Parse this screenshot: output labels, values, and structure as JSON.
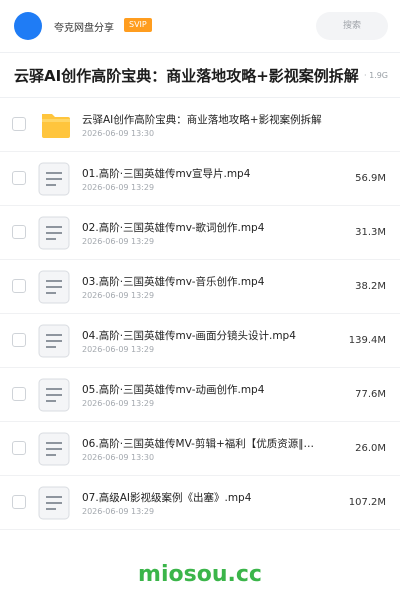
{
  "header": {
    "sharer_name": "夸克网盘分享",
    "badge": "SVIP",
    "search_placeholder": "搜索"
  },
  "folder": {
    "title": "云驿AI创作高阶宝典：商业落地攻略+影视案例拆解",
    "total_size": "· 1.9G"
  },
  "files": [
    {
      "type": "folder",
      "name": "云驿AI创作高阶宝典：商业落地攻略+影视案例拆解",
      "date": "2026-06-09 13:30",
      "size": ""
    },
    {
      "type": "video",
      "name": "01.高阶·三国英雄传mv宣导片.mp4",
      "date": "2026-06-09 13:29",
      "size": "56.9M"
    },
    {
      "type": "video",
      "name": "02.高阶·三国英雄传mv-歌词创作.mp4",
      "date": "2026-06-09 13:29",
      "size": "31.3M"
    },
    {
      "type": "video",
      "name": "03.高阶·三国英雄传mv-音乐创作.mp4",
      "date": "2026-06-09 13:29",
      "size": "38.2M"
    },
    {
      "type": "video",
      "name": "04.高阶·三国英雄传mv-画面分镜头设计.mp4",
      "date": "2026-06-09 13:29",
      "size": "139.4M"
    },
    {
      "type": "video",
      "name": "05.高阶·三国英雄传mv-动画创作.mp4",
      "date": "2026-06-09 13:29",
      "size": "77.6M"
    },
    {
      "type": "video",
      "name": "06.高阶·三国英雄传MV-剪辑+福利【优质资源‖…",
      "date": "2026-06-09 13:30",
      "size": "26.0M"
    },
    {
      "type": "video",
      "name": "07.高级AI影视级案例《出塞》.mp4",
      "date": "2026-06-09 13:29",
      "size": "107.2M"
    }
  ],
  "watermark": "miosou.cc",
  "colors": {
    "accent": "#1f7cf5",
    "svip": "#ff9d1f",
    "folder": "#ffc53d",
    "watermark": "#3bb54a"
  }
}
